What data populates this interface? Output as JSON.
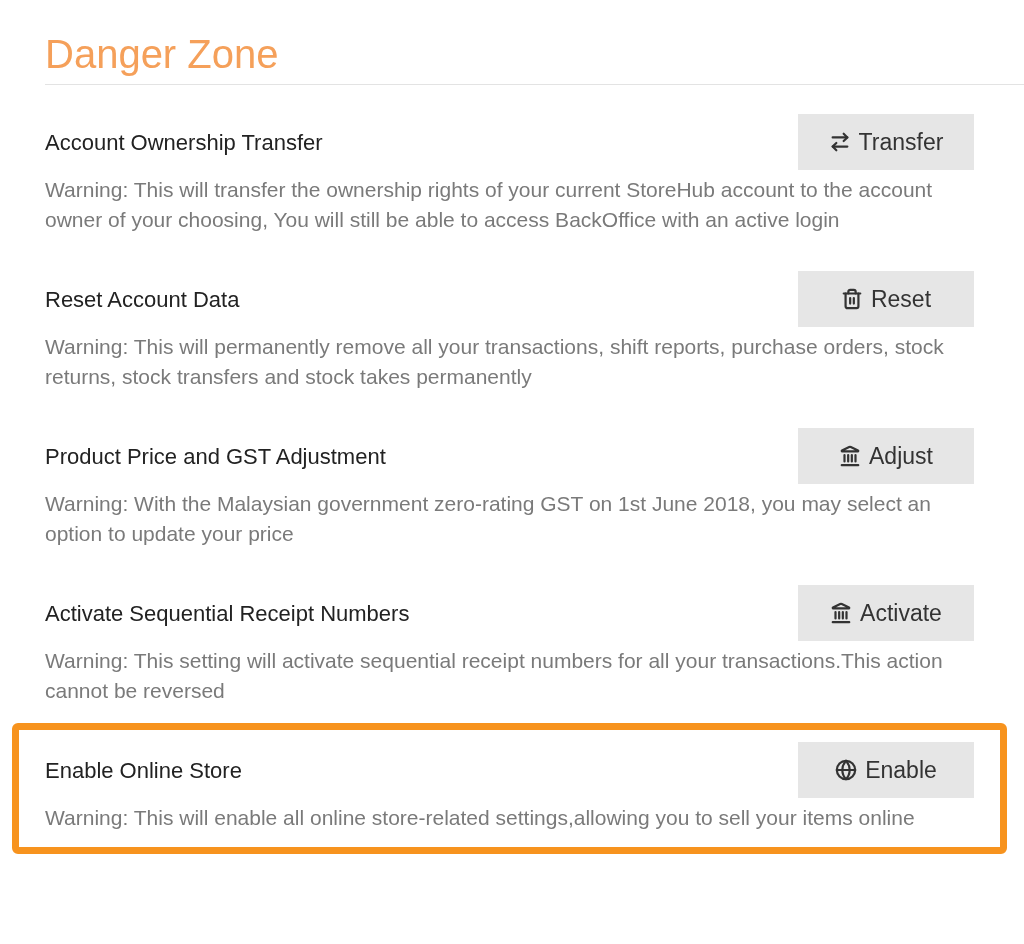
{
  "heading": "Danger Zone",
  "items": [
    {
      "title": "Account Ownership Transfer",
      "button": {
        "label": "Transfer",
        "kind": "transfer"
      },
      "warning": "Warning: This will transfer the ownership rights of your current StoreHub account to the account owner of your choosing, You will still be able to access BackOffice with an active login",
      "highlighted": false
    },
    {
      "title": "Reset Account Data",
      "button": {
        "label": "Reset",
        "kind": "trash"
      },
      "warning": "Warning: This will permanently remove all your transactions, shift reports, purchase orders, stock returns, stock transfers and stock takes permanently",
      "highlighted": false
    },
    {
      "title": "Product Price and GST Adjustment",
      "button": {
        "label": "Adjust",
        "kind": "bank"
      },
      "warning": "Warning: With the Malaysian government zero-rating GST on 1st June 2018, you may select an option to update your price",
      "highlighted": false
    },
    {
      "title": "Activate Sequential Receipt Numbers",
      "button": {
        "label": "Activate",
        "kind": "bank"
      },
      "warning": "Warning: This setting will activate sequential receipt numbers for all your transactions.This action cannot be reversed",
      "highlighted": false
    },
    {
      "title": "Enable Online Store",
      "button": {
        "label": "Enable",
        "kind": "globe"
      },
      "warning": "Warning: This will enable all online store-related settings,allowing you to sell your items online",
      "highlighted": true
    }
  ]
}
